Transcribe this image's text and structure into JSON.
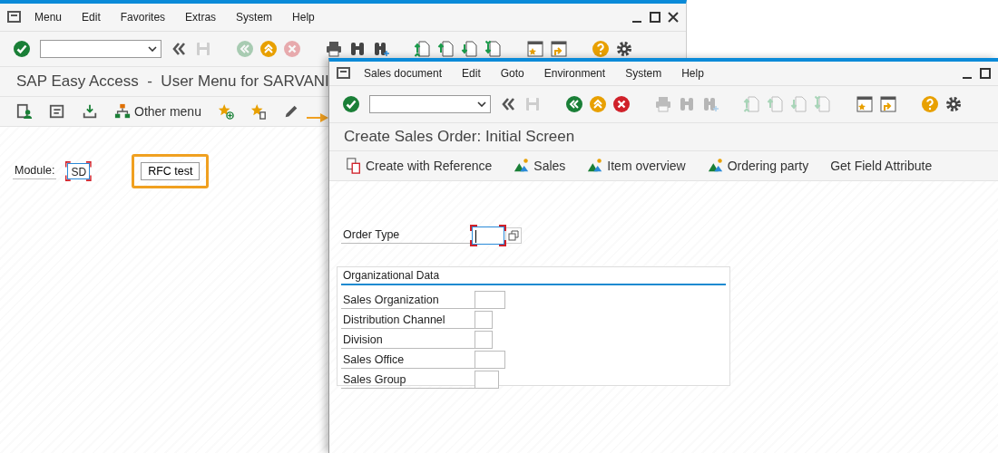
{
  "back_window": {
    "menu": [
      "Menu",
      "Edit",
      "Favorites",
      "Extras",
      "System",
      "Help"
    ],
    "toolbar": [
      {
        "kind": "check",
        "disabled": false
      },
      {
        "kind": "back",
        "disabled": false
      },
      {
        "kind": "save",
        "disabled": true
      },
      {
        "kind": "nav-back",
        "disabled": true
      },
      {
        "kind": "nav-up",
        "disabled": false
      },
      {
        "kind": "cancel",
        "disabled": true
      },
      {
        "kind": "print",
        "disabled": false
      },
      {
        "kind": "find",
        "disabled": false
      },
      {
        "kind": "find-next",
        "disabled": false
      },
      {
        "kind": "page-first",
        "disabled": false
      },
      {
        "kind": "page-prev",
        "disabled": false
      },
      {
        "kind": "page-next",
        "disabled": false
      },
      {
        "kind": "page-last",
        "disabled": false
      },
      {
        "kind": "new-session",
        "disabled": false
      },
      {
        "kind": "shortcut",
        "disabled": false
      },
      {
        "kind": "help",
        "disabled": false
      },
      {
        "kind": "settings",
        "disabled": false
      }
    ],
    "title": "SAP Easy Access  -  User Menu for SARVANI",
    "app_toolbar": [
      {
        "kind": "user-menu"
      },
      {
        "kind": "sap-menu"
      },
      {
        "kind": "download"
      },
      {
        "kind": "hierarchy",
        "label": "Other menu"
      },
      {
        "kind": "star-add"
      },
      {
        "kind": "star-delete"
      },
      {
        "kind": "pencil"
      }
    ],
    "module": {
      "label": "Module:",
      "value": "SD",
      "focused": true
    },
    "rfc_button": {
      "label": "RFC test",
      "highlighted": true
    }
  },
  "front_window": {
    "menu": [
      "Sales document",
      "Edit",
      "Goto",
      "Environment",
      "System",
      "Help"
    ],
    "toolbar": [
      {
        "kind": "check",
        "disabled": false
      },
      {
        "kind": "back",
        "disabled": false
      },
      {
        "kind": "save",
        "disabled": true
      },
      {
        "kind": "nav-back",
        "disabled": false
      },
      {
        "kind": "nav-up",
        "disabled": false
      },
      {
        "kind": "cancel",
        "disabled": false
      },
      {
        "kind": "print",
        "disabled": true
      },
      {
        "kind": "find",
        "disabled": true
      },
      {
        "kind": "find-next",
        "disabled": true
      },
      {
        "kind": "page-first",
        "disabled": true
      },
      {
        "kind": "page-prev",
        "disabled": true
      },
      {
        "kind": "page-next",
        "disabled": true
      },
      {
        "kind": "page-last",
        "disabled": true
      },
      {
        "kind": "new-session",
        "disabled": false
      },
      {
        "kind": "shortcut",
        "disabled": false
      },
      {
        "kind": "help",
        "disabled": false
      },
      {
        "kind": "settings",
        "disabled": false
      }
    ],
    "title": "Create Sales Order: Initial Screen",
    "app_toolbar": [
      {
        "kind": "document",
        "label": "Create with Reference"
      },
      {
        "kind": "mountain",
        "label": "Sales"
      },
      {
        "kind": "mountain",
        "label": "Item overview"
      },
      {
        "kind": "mountain",
        "label": "Ordering party"
      },
      {
        "kind": "text",
        "label": "Get Field Attribute"
      }
    ],
    "order_type": {
      "label": "Order Type",
      "focused": true
    },
    "organizational_data": {
      "title": "Organizational Data",
      "fields": [
        {
          "label": "Sales Organization",
          "kind": "wide"
        },
        {
          "label": "Distribution Channel",
          "kind": "narrow"
        },
        {
          "label": "Division",
          "kind": "narrow"
        },
        {
          "label": "Sales Office",
          "kind": "wide"
        },
        {
          "label": "Sales Group",
          "kind": "medium"
        }
      ]
    }
  }
}
